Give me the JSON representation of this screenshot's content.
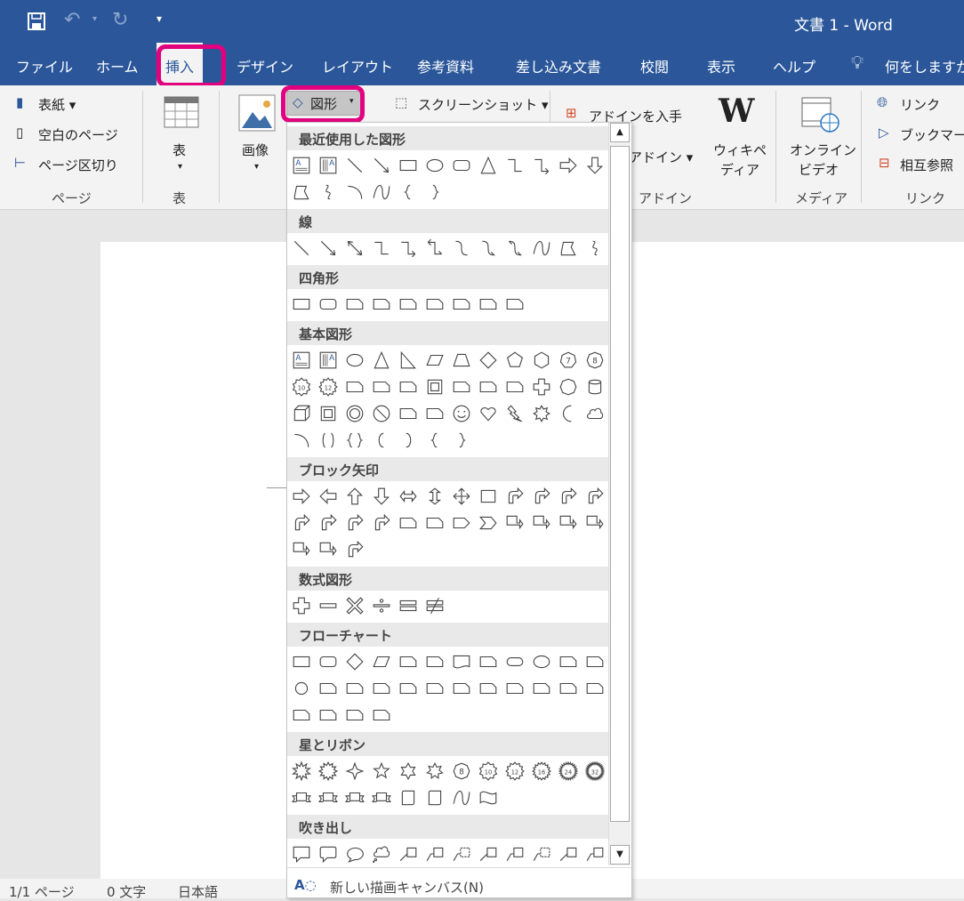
{
  "title": "文書 1  -  Word",
  "quick_access": [
    "save-icon",
    "undo-icon",
    "redo-icon",
    "customize-icon"
  ],
  "tabs": [
    "ファイル",
    "ホーム",
    "挿入",
    "デザイン",
    "レイアウト",
    "参考資料",
    "差し込み文書",
    "校閲",
    "表示",
    "ヘルプ"
  ],
  "active_tab": "挿入",
  "tell_me": "何をしますか",
  "ribbon": {
    "pages": {
      "cover": "表紙",
      "blank": "空白のページ",
      "break": "ページ区切り",
      "group": "ページ"
    },
    "table": {
      "label": "表",
      "group": "表"
    },
    "picture": "画像",
    "shapes": "図形",
    "screenshot": "スクリーンショット",
    "addins": {
      "get": "アドインを入手",
      "my": "個人用アドイン",
      "wiki_1": "ウィキペ",
      "wiki_2": "ディア",
      "group": "アドイン"
    },
    "media": {
      "video_1": "オンライン",
      "video_2": "ビデオ",
      "group": "メディア"
    },
    "links": {
      "link": "リンク",
      "bookmark": "ブックマーク",
      "xref": "相互参照",
      "group": "リンク"
    }
  },
  "accent": "#2b579a",
  "highlight": "#e3007f",
  "gallery": {
    "sections": [
      {
        "title": "最近使用した図形",
        "rows": [
          [
            "textbox",
            "vtextbox",
            "line",
            "arrowline",
            "rect",
            "ellipse",
            "roundrect",
            "triangle",
            "elbow",
            "elbowarrow",
            "arrowR",
            "arrowD"
          ],
          [
            "freeform",
            "scribble",
            "arc",
            "wave",
            "braceL",
            "braceR"
          ]
        ]
      },
      {
        "title": "線",
        "rows": [
          [
            "line",
            "arrowline",
            "dblarrow",
            "elbow",
            "elbowarrow",
            "elbowdbl",
            "curve",
            "curvearrow",
            "curvedbl",
            "wave",
            "freeform",
            "scribble"
          ]
        ]
      },
      {
        "title": "四角形",
        "rows": [
          [
            "rect",
            "roundrect",
            "snip1",
            "snip2",
            "snip3",
            "snipround",
            "round1",
            "round2",
            "round3"
          ]
        ]
      },
      {
        "title": "基本図形",
        "rows": [
          [
            "textbox",
            "vtextbox",
            "ellipse",
            "triangle",
            "rtriangle",
            "parallelogram",
            "trapezoid",
            "diamond",
            "pentagon",
            "hexagon",
            "n7",
            "n8"
          ],
          [
            "n10",
            "n12",
            "pie",
            "chord",
            "teardrop",
            "frame",
            "halfframe",
            "lshape",
            "diagstripe",
            "plus",
            "octagon",
            "cylinder"
          ],
          [
            "cube",
            "bevel",
            "donut",
            "nosign",
            "blockarc",
            "foldedcorner",
            "smiley",
            "heart",
            "lightning",
            "sun",
            "moon",
            "cloud"
          ],
          [
            "arc",
            "brackets",
            "braces",
            "bracketL",
            "bracketR",
            "braceL",
            "braceR"
          ]
        ]
      },
      {
        "title": "ブロック矢印",
        "rows": [
          [
            "arrowR",
            "arrowL",
            "arrowU",
            "arrowD",
            "arrowLR",
            "arrowUD",
            "arrow4",
            "arrowLRU",
            "bentarrow",
            "uturn",
            "leftup",
            "bentup"
          ],
          [
            "curveR",
            "curveL",
            "curveU",
            "curveD",
            "stripedR",
            "notchedR",
            "pentarrow",
            "chevron",
            "calloutR",
            "calloutD",
            "calloutL",
            "calloutU"
          ],
          [
            "calloutLR",
            "callout4",
            "circular"
          ]
        ]
      },
      {
        "title": "数式図形",
        "rows": [
          [
            "plus",
            "minus",
            "times",
            "divide",
            "equal",
            "notequal"
          ]
        ]
      },
      {
        "title": "フローチャート",
        "rows": [
          [
            "rect",
            "roundrect",
            "diamond",
            "parallelogram",
            "predefined",
            "internal",
            "document",
            "multidoc",
            "terminator",
            "ellipse",
            "manualinput",
            "manualop"
          ],
          [
            "circle",
            "offpage",
            "card",
            "tape",
            "sumjunction",
            "or",
            "collate",
            "sort",
            "extract",
            "merge",
            "storeddata",
            "delay"
          ],
          [
            "seqaccess",
            "magdisk",
            "directaccess",
            "display"
          ]
        ]
      },
      {
        "title": "星とリボン",
        "rows": [
          [
            "burst1",
            "burst2",
            "star4",
            "star5",
            "star6",
            "star7",
            "n8",
            "n10",
            "n12",
            "n16",
            "n24",
            "n32"
          ],
          [
            "ribbonD",
            "ribbonU",
            "curvedribbonD",
            "curvedribbonU",
            "scrollV",
            "scrollH",
            "wave",
            "dblwave"
          ]
        ]
      },
      {
        "title": "吹き出し",
        "rows": [
          [
            "callrect",
            "callround",
            "callellipse",
            "callcloud",
            "line1",
            "line2",
            "line3",
            "line1",
            "line2",
            "line3",
            "line1",
            "line2"
          ]
        ]
      }
    ],
    "new_canvas": "新しい描画キャンバス(N)"
  },
  "status": {
    "page": "1/1 ページ",
    "words": "0 文字",
    "lang": "日本語"
  }
}
